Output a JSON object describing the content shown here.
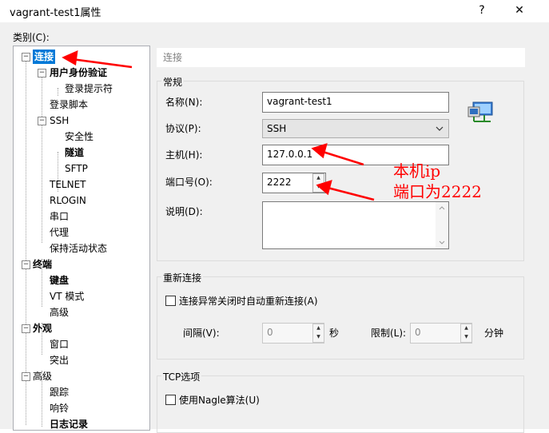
{
  "window": {
    "title": "vagrant-test1属性",
    "help_glyph": "?",
    "close_glyph": "✕"
  },
  "category_label": "类别(C):",
  "tree": {
    "items": [
      {
        "label": "连接"
      },
      {
        "label": "用户身份验证"
      },
      {
        "label": "登录提示符"
      },
      {
        "label": "登录脚本"
      },
      {
        "label": "SSH"
      },
      {
        "label": "安全性"
      },
      {
        "label": "隧道"
      },
      {
        "label": "SFTP"
      },
      {
        "label": "TELNET"
      },
      {
        "label": "RLOGIN"
      },
      {
        "label": "串口"
      },
      {
        "label": "代理"
      },
      {
        "label": "保持活动状态"
      },
      {
        "label": "终端"
      },
      {
        "label": "键盘"
      },
      {
        "label": "VT 模式"
      },
      {
        "label": "高级"
      },
      {
        "label": "外观"
      },
      {
        "label": "窗口"
      },
      {
        "label": "突出"
      },
      {
        "label": "高级"
      },
      {
        "label": "跟踪"
      },
      {
        "label": "响铃"
      },
      {
        "label": "日志记录"
      }
    ],
    "expander_minus": "−"
  },
  "section_title": "连接",
  "general": {
    "title": "常规",
    "name_label": "名称(N):",
    "name_value": "vagrant-test1",
    "protocol_label": "协议(P):",
    "protocol_value": "SSH",
    "host_label": "主机(H):",
    "host_value": "127.0.0.1",
    "port_label": "端口号(O):",
    "port_value": "2222",
    "desc_label": "说明(D):",
    "desc_value": ""
  },
  "reconnect": {
    "title": "重新连接",
    "checkbox_label": "连接异常关闭时自动重新连接(A)",
    "interval_label": "间隔(V):",
    "interval_value": "0",
    "interval_unit": "秒",
    "limit_label": "限制(L):",
    "limit_value": "0",
    "limit_unit": "分钟"
  },
  "tcp": {
    "title": "TCP选项",
    "checkbox_label": "使用Nagle算法(U)"
  },
  "annotation": {
    "line1": "本机ip",
    "line2": "端口为2222",
    "color": "#ff0000"
  }
}
